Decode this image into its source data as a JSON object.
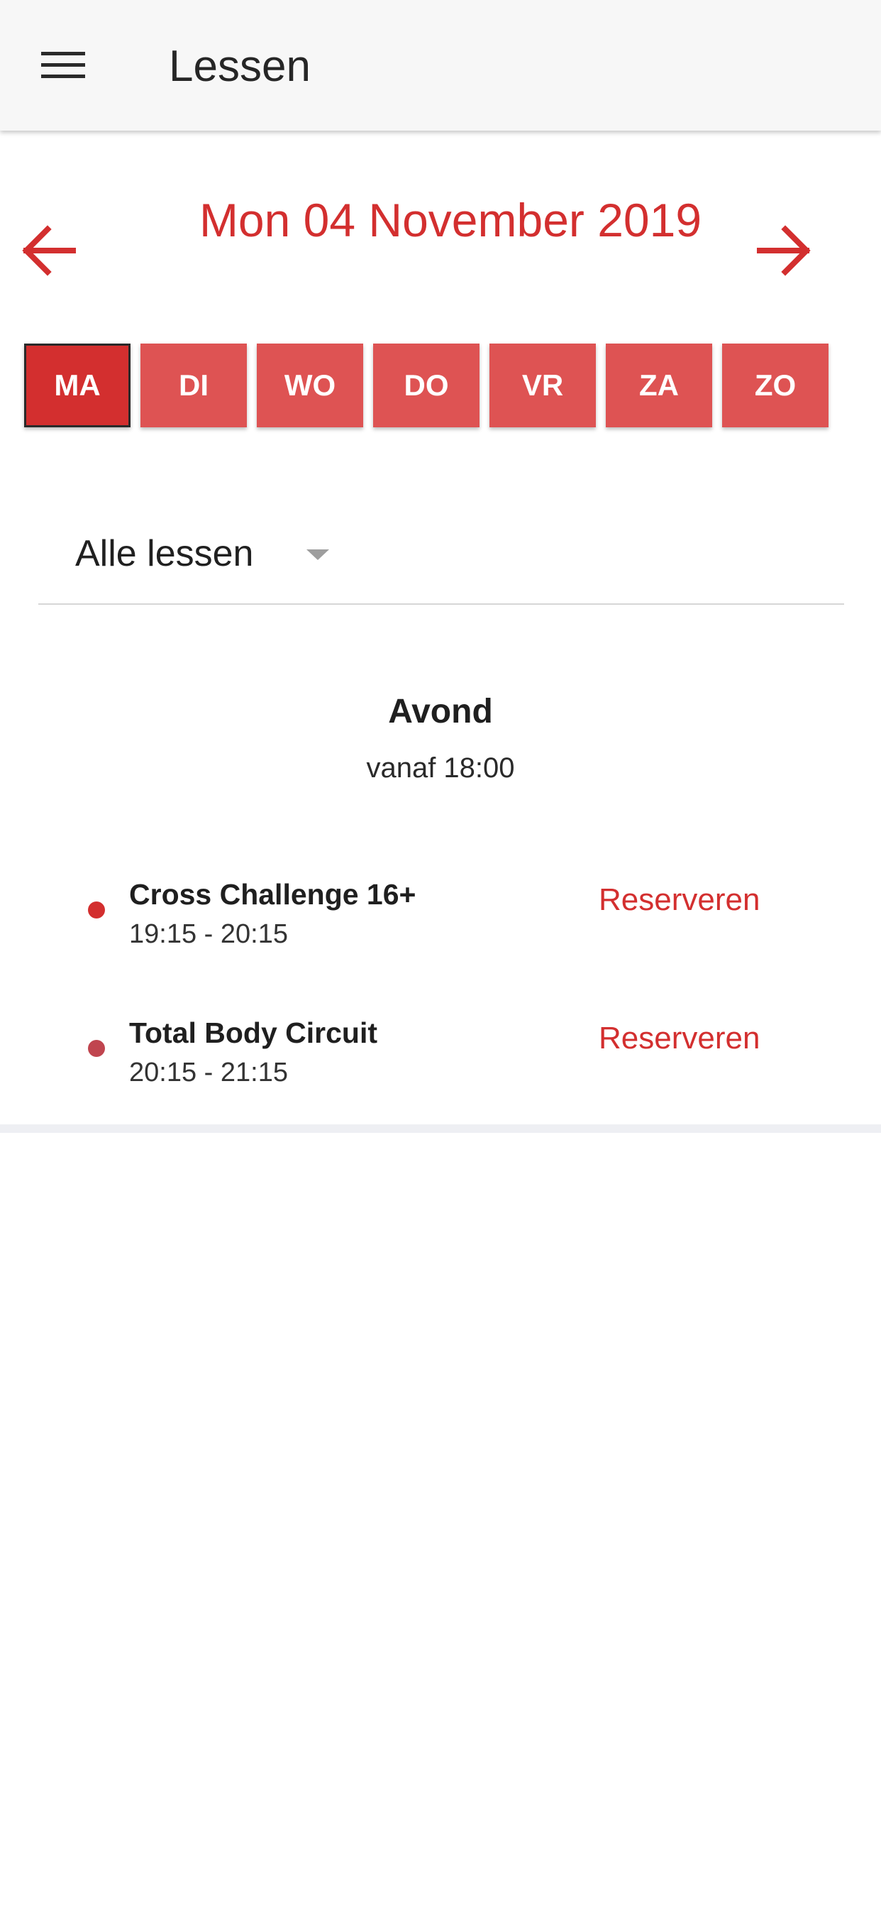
{
  "app_bar": {
    "title": "Lessen",
    "menu_icon": "hamburger-menu-icon"
  },
  "date_nav": {
    "label": "Mon 04 November 2019",
    "prev_icon": "arrow-left-icon",
    "next_icon": "arrow-right-icon",
    "color": "#d32f2f"
  },
  "day_tabs": [
    {
      "label": "MA",
      "active": true
    },
    {
      "label": "DI",
      "active": false
    },
    {
      "label": "WO",
      "active": false
    },
    {
      "label": "DO",
      "active": false
    },
    {
      "label": "VR",
      "active": false
    },
    {
      "label": "ZA",
      "active": false
    },
    {
      "label": "ZO",
      "active": false
    }
  ],
  "filter": {
    "selected": "Alle lessen",
    "icon": "dropdown-caret-icon"
  },
  "section": {
    "title": "Avond",
    "subtitle": "vanaf 18:00"
  },
  "lessons": [
    {
      "name": "Cross Challenge 16+",
      "time": "19:15 - 20:15",
      "action": "Reserveren",
      "dot_color": "#d32f2f"
    },
    {
      "name": "Total Body Circuit",
      "time": "20:15 - 21:15",
      "action": "Reserveren",
      "dot_color": "#c0454f"
    }
  ],
  "colors": {
    "accent": "#d32f2f",
    "tab": "#de5353",
    "app_bar": "#f7f7f7"
  }
}
